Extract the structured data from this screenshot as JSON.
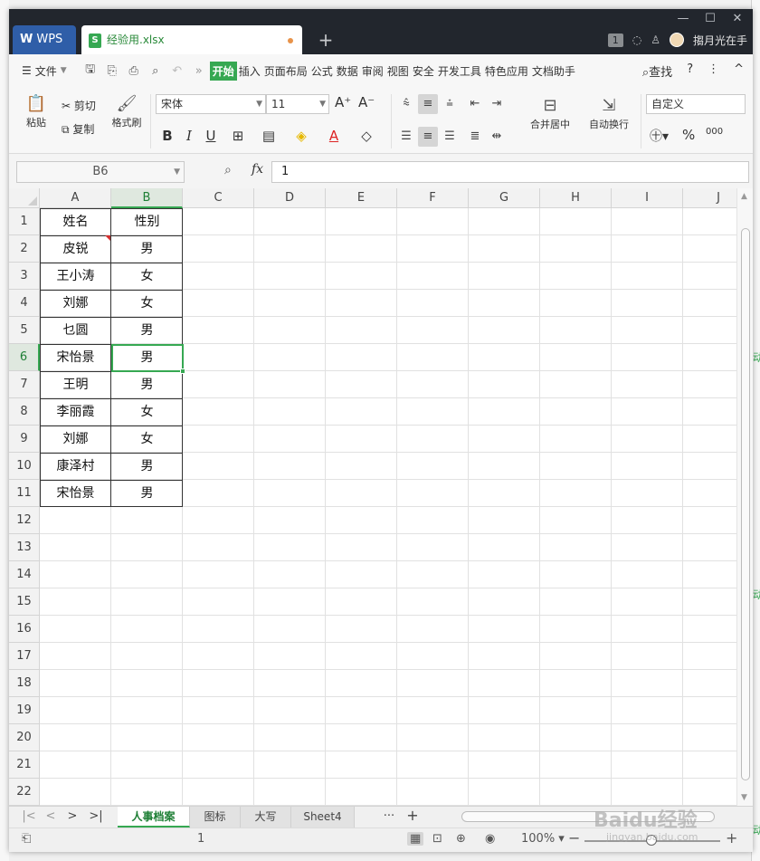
{
  "titlebar": {
    "app_tab": "WPS",
    "file_tab": "经验用.xlsx",
    "new_tab_icon": "plus-icon",
    "badge_count": "1",
    "user_name": "搊月光在手",
    "controls": [
      "minimize-icon",
      "maximize-icon",
      "close-icon"
    ]
  },
  "menu": {
    "file_label": "文件",
    "items": [
      "开始",
      "插入",
      "页面布局",
      "公式",
      "数据",
      "审阅",
      "视图",
      "安全",
      "开发工具",
      "特色应用",
      "文档助手"
    ],
    "active_index": 0,
    "search_label": "查找",
    "help_icon": "?",
    "more_icon": "⋮",
    "collapse_icon": "^"
  },
  "ribbon": {
    "paste_label": "粘贴",
    "cut_label": "剪切",
    "copy_label": "复制",
    "format_painter_label": "格式刷",
    "font_name": "宋体",
    "font_size": "11",
    "merge_label": "合并居中",
    "wrap_label": "自动换行",
    "number_format": "自定义",
    "bold": "B",
    "italic": "I",
    "underline": "U",
    "grow_font": "A⁺",
    "shrink_font": "A⁻",
    "percent": "%",
    "thousands": "000"
  },
  "formula_bar": {
    "name_box": "B6",
    "fx_label": "fx",
    "value": "1"
  },
  "grid": {
    "columns": [
      "A",
      "B",
      "C",
      "D",
      "E",
      "F",
      "G",
      "H",
      "I",
      "J"
    ],
    "rows": [
      "1",
      "2",
      "3",
      "4",
      "5",
      "6",
      "7",
      "8",
      "9",
      "10",
      "11",
      "12",
      "13",
      "14",
      "15",
      "16",
      "17",
      "18",
      "19",
      "20",
      "21",
      "22"
    ],
    "selected_column": "B",
    "selected_row": "6",
    "table": [
      [
        "姓名",
        "性别"
      ],
      [
        "皮锐",
        "男"
      ],
      [
        "王小涛",
        "女"
      ],
      [
        "刘娜",
        "女"
      ],
      [
        "乜圆",
        "男"
      ],
      [
        "宋怡景",
        "男"
      ],
      [
        "王明",
        "男"
      ],
      [
        "李丽霞",
        "女"
      ],
      [
        "刘娜",
        "女"
      ],
      [
        "康泽村",
        "男"
      ],
      [
        "宋怡景",
        "男"
      ]
    ]
  },
  "sheets": {
    "tabs": [
      "人事档案",
      "图标",
      "大写",
      "Sheet4"
    ],
    "active": "人事档案",
    "more_icon": "···",
    "add_icon": "+"
  },
  "statusbar": {
    "value_text": "1",
    "zoom_level": "100%",
    "zoom_out": "−",
    "zoom_in": "+"
  },
  "colors": {
    "accent": "#36a852",
    "titlebar": "#22262d",
    "wps_tab": "#2f5ea8"
  },
  "watermark": {
    "main": "Baidu经验",
    "sub": "jingyan.baidu.com"
  }
}
